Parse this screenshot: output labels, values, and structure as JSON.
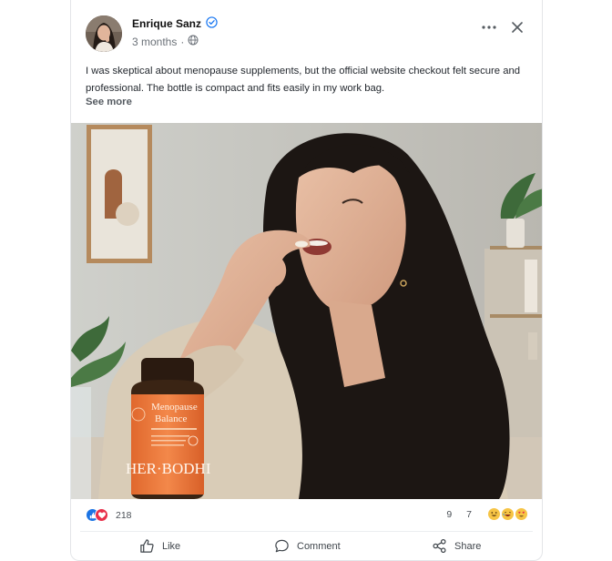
{
  "post": {
    "author": "Enrique Sanz",
    "time": "3 months",
    "separator": "·",
    "text": "I was skeptical about menopause supplements, but the official website checkout felt secure and professional. The bottle is compact and fits easily in my work bag.",
    "see_more": "See more"
  },
  "photo": {
    "bottle_title_line1": "Menopause",
    "bottle_title_line2": "Balance",
    "bottle_brand": "HER·BODHI"
  },
  "stats": {
    "reactions": "218",
    "comments": "9",
    "shares": "7"
  },
  "actions": {
    "like": "Like",
    "comment": "Comment",
    "share": "Share"
  },
  "icons": [
    "verified-icon",
    "globe-icon",
    "more-icon",
    "close-icon",
    "like-icon",
    "comment-icon",
    "share-icon"
  ],
  "colors": {
    "verified": "#1877f2",
    "like_reaction": "#1b74e4",
    "love_reaction": "#e8304a",
    "bottle_label": "#ef7a3a"
  }
}
